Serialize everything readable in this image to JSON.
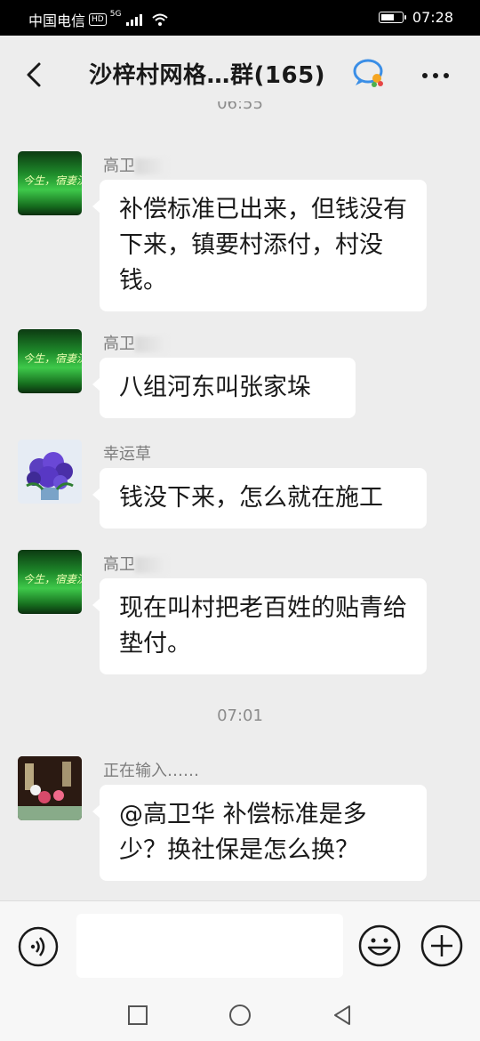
{
  "status_bar": {
    "carrier": "中国电信",
    "hd": "HD",
    "network": "5G",
    "time": "07:28"
  },
  "header": {
    "title": "沙梓村网格…群(165)",
    "back_icon": "chevron-left-icon",
    "more_icon": "more-dots-icon",
    "group_icon": "chat-bubble-icon"
  },
  "timestamps": {
    "top_partial": "06:55",
    "middle": "07:01"
  },
  "messages": [
    {
      "sender": "高卫",
      "text": "补偿标准已出来，但钱没有下来，镇要村添付，村没钱。"
    },
    {
      "sender": "高卫",
      "text": "八组河东叫张家垛"
    },
    {
      "sender": "幸运草",
      "text": "钱没下来，怎么就在施工"
    },
    {
      "sender": "高卫",
      "text": "现在叫村把老百姓的贴青给垫付。"
    },
    {
      "sender": "正在输入……",
      "text": "@高卫华  补偿标准是多少？换社保是怎么换？"
    }
  ],
  "avatar_caption": "今生，宿妻沉浮",
  "input_bar": {
    "text_value": "",
    "voice_icon": "voice-icon",
    "emoji_icon": "emoji-icon",
    "plus_icon": "plus-icon"
  },
  "nav": {
    "square_icon": "recent-apps-icon",
    "circle_icon": "home-icon",
    "triangle_icon": "back-triangle-icon"
  }
}
